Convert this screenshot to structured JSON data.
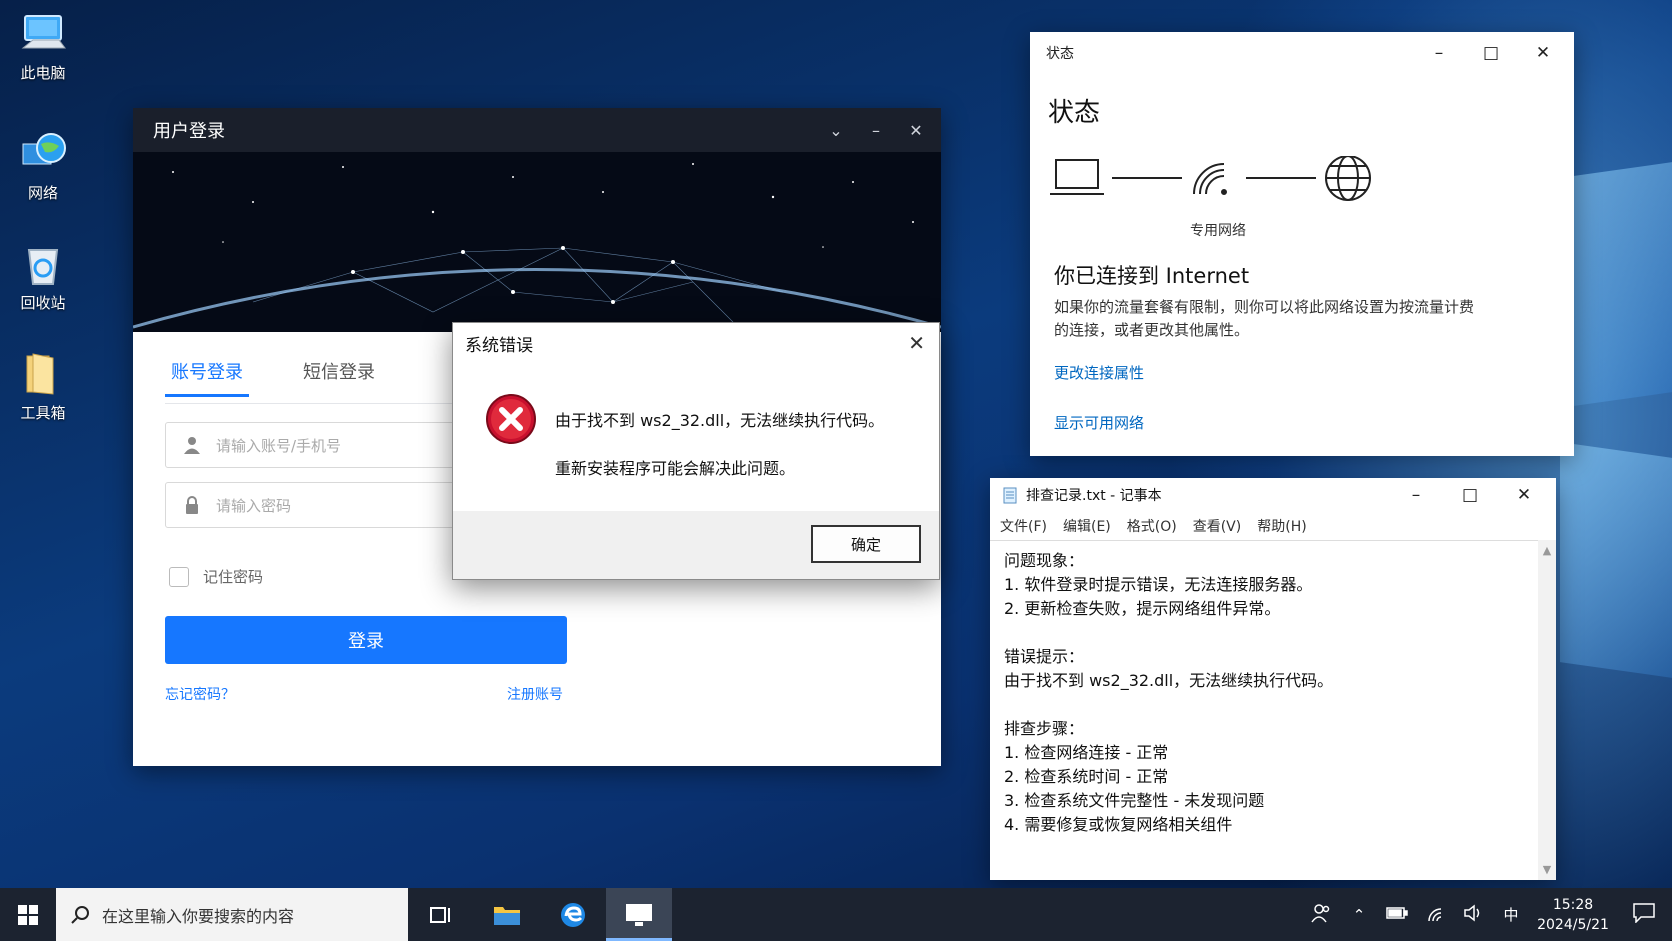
{
  "desktop": {
    "icons": [
      {
        "label": "此电脑",
        "icon": "computer-icon"
      },
      {
        "label": "网络",
        "icon": "network-globe-icon"
      },
      {
        "label": "回收站",
        "icon": "recycle-bin-icon"
      },
      {
        "label": "工具箱",
        "icon": "folder-icon"
      }
    ]
  },
  "login_window": {
    "title": "用户登录",
    "tabs": [
      {
        "label": "账号登录",
        "active": true
      },
      {
        "label": "短信登录",
        "active": false
      }
    ],
    "account_placeholder": "请输入账号/手机号",
    "password_placeholder": "请输入密码",
    "remember_label": "记住密码",
    "login_button": "登录",
    "forgot_link": "忘记密码？",
    "register_link": "注册账号",
    "accent": "#1677ff"
  },
  "error_dialog": {
    "title": "系统错误",
    "message1": "由于找不到 ws2_32.dll，无法继续执行代码。",
    "message2": "重新安装程序可能会解决此问题。",
    "ok_button": "确定"
  },
  "network_window": {
    "title": "状态",
    "heading": "状态",
    "network_name": "专用网络",
    "connected_title": "你已连接到 Internet",
    "description": "如果你的流量套餐有限制，则你可以将此网络设置为按流量计费的连接，或者更改其他属性。",
    "links": [
      "更改连接属性",
      "显示可用网络"
    ]
  },
  "notepad": {
    "title": "排查记录.txt - 记事本",
    "menu": [
      "文件(F)",
      "编辑(E)",
      "格式(O)",
      "查看(V)",
      "帮助(H)"
    ],
    "lines": [
      "问题现象：",
      "1. 软件登录时提示错误，无法连接服务器。",
      "2. 更新检查失败，提示网络组件异常。",
      "",
      "错误提示：",
      "由于找不到 ws2_32.dll，无法继续执行代码。",
      "",
      "排查步骤：",
      "1. 检查网络连接 - 正常",
      "2. 检查系统时间 - 正常",
      "3. 检查系统文件完整性 - 未发现问题",
      "4. 需要修复或恢复网络相关组件"
    ]
  },
  "taskbar": {
    "search_placeholder": "在这里输入你要搜索的内容",
    "ime": "中",
    "time": "15:28",
    "date": "2024/5/21"
  }
}
